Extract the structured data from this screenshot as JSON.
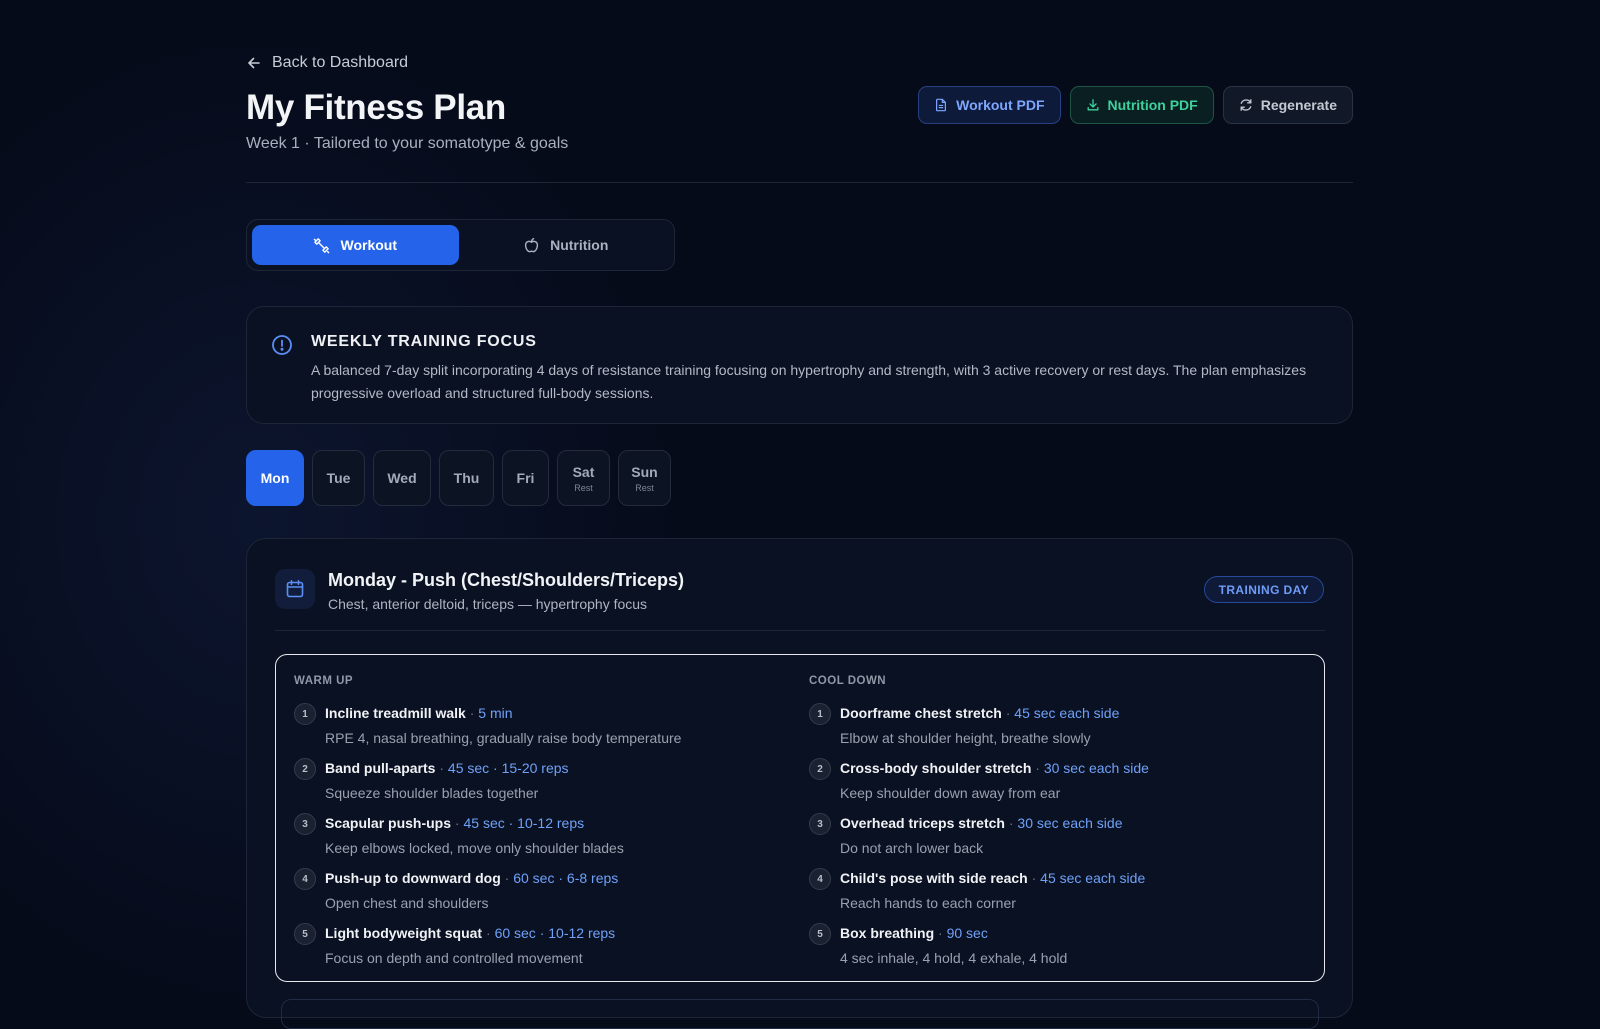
{
  "nav": {
    "back_label": "Back to Dashboard"
  },
  "header": {
    "title": "My Fitness Plan",
    "subtitle": "Week 1 · Tailored to your somatotype & goals"
  },
  "actions": {
    "workout_pdf": "Workout PDF",
    "nutrition_pdf": "Nutrition PDF",
    "regenerate": "Regenerate"
  },
  "modes": {
    "workout": "Workout",
    "nutrition": "Nutrition",
    "active": "workout"
  },
  "focus": {
    "title": "WEEKLY TRAINING FOCUS",
    "text": "A balanced 7-day split incorporating 4 days of resistance training focusing on hypertrophy and strength, with 3 active recovery or rest days. The plan emphasizes progressive overload and structured full-body sessions."
  },
  "days": [
    {
      "label": "Mon",
      "sub": "",
      "active": true
    },
    {
      "label": "Tue",
      "sub": ""
    },
    {
      "label": "Wed",
      "sub": ""
    },
    {
      "label": "Thu",
      "sub": ""
    },
    {
      "label": "Fri",
      "sub": ""
    },
    {
      "label": "Sat",
      "sub": "Rest"
    },
    {
      "label": "Sun",
      "sub": "Rest"
    }
  ],
  "day_detail": {
    "title": "Monday - Push (Chest/Shoulders/Triceps)",
    "description": "Chest, anterior deltoid, triceps — hypertrophy focus",
    "badge": "TRAINING DAY",
    "warm_up": {
      "heading": "WARM UP",
      "items": [
        {
          "num": "1",
          "name": "Incline treadmill walk",
          "detail": "5 min",
          "note": "RPE 4, nasal breathing, gradually raise body temperature"
        },
        {
          "num": "2",
          "name": "Band pull-aparts",
          "detail": "45 sec · 15-20 reps",
          "note": "Squeeze shoulder blades together"
        },
        {
          "num": "3",
          "name": "Scapular push-ups",
          "detail": "45 sec · 10-12 reps",
          "note": "Keep elbows locked, move only shoulder blades"
        },
        {
          "num": "4",
          "name": "Push-up to downward dog",
          "detail": "60 sec · 6-8 reps",
          "note": "Open chest and shoulders"
        },
        {
          "num": "5",
          "name": "Light bodyweight squat",
          "detail": "60 sec · 10-12 reps",
          "note": "Focus on depth and controlled movement"
        }
      ]
    },
    "cool_down": {
      "heading": "COOL DOWN",
      "items": [
        {
          "num": "1",
          "name": "Doorframe chest stretch",
          "detail": "45 sec each side",
          "note": "Elbow at shoulder height, breathe slowly"
        },
        {
          "num": "2",
          "name": "Cross-body shoulder stretch",
          "detail": "30 sec each side",
          "note": "Keep shoulder down away from ear"
        },
        {
          "num": "3",
          "name": "Overhead triceps stretch",
          "detail": "30 sec each side",
          "note": "Do not arch lower back"
        },
        {
          "num": "4",
          "name": "Child's pose with side reach",
          "detail": "45 sec each side",
          "note": "Reach hands to each corner"
        },
        {
          "num": "5",
          "name": "Box breathing",
          "detail": "90 sec",
          "note": "4 sec inhale, 4 hold, 4 exhale, 4 hold"
        }
      ]
    }
  },
  "colors": {
    "accent": "#2563eb",
    "accent_text": "#6fa1f8",
    "nutrition_green": "#3fd19b",
    "background": "#060b1a"
  }
}
